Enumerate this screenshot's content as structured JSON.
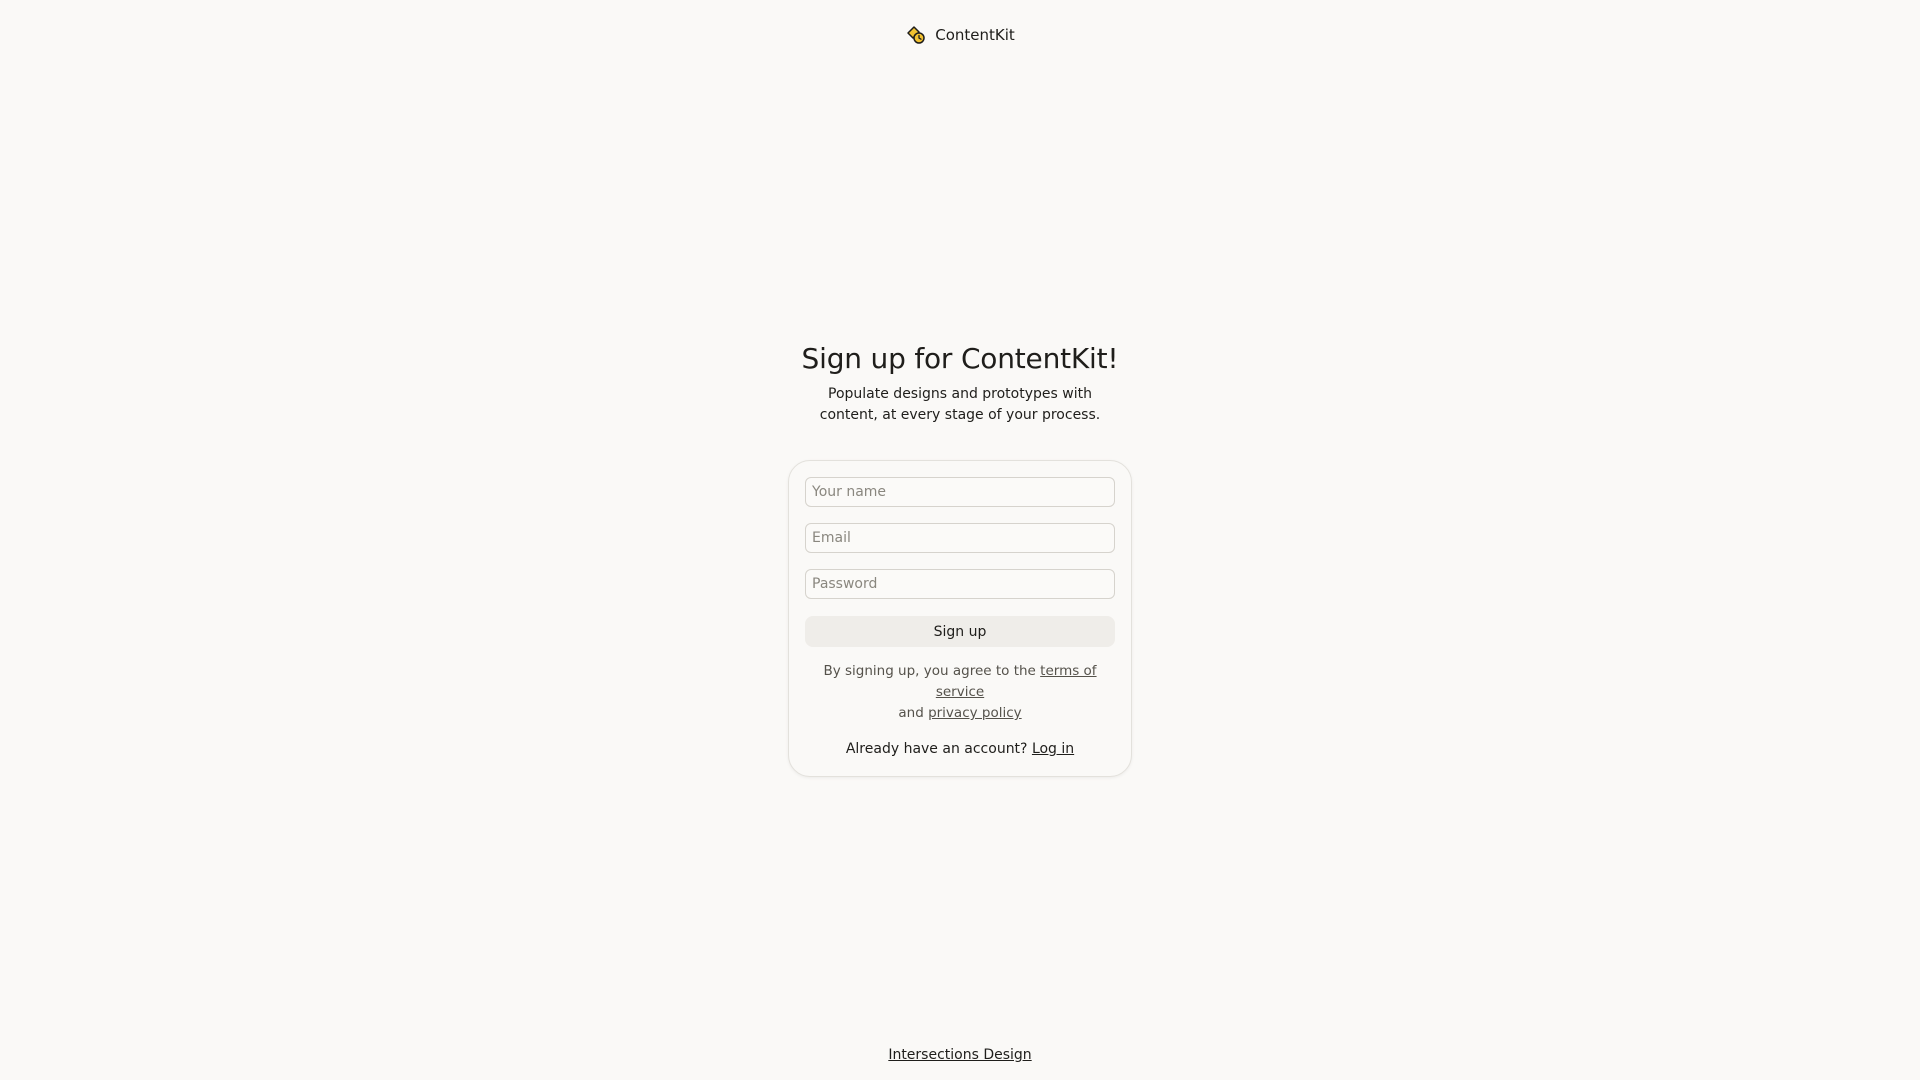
{
  "brand": {
    "name": "ContentKit",
    "icon": "contentkit-logo-icon",
    "icon_color": "#f2c230"
  },
  "main": {
    "title": "Sign up for ContentKit!",
    "subtitle": "Populate designs and prototypes with content, at every stage of your process."
  },
  "form": {
    "name_placeholder": "Your name",
    "name_value": "",
    "email_placeholder": "Email",
    "email_value": "",
    "password_placeholder": "Password",
    "password_value": "",
    "submit_label": "Sign up"
  },
  "legal": {
    "prefix": "By signing up, you agree to the",
    "terms_link": "terms of service",
    "and": "and",
    "privacy_link": "privacy policy"
  },
  "login": {
    "prompt": "Already have an account?",
    "link": "Log in"
  },
  "footer": {
    "link": "Intersections Design"
  },
  "colors": {
    "background": "#faf9f7",
    "button_bg": "#efede9",
    "text": "#1f1e1b"
  }
}
